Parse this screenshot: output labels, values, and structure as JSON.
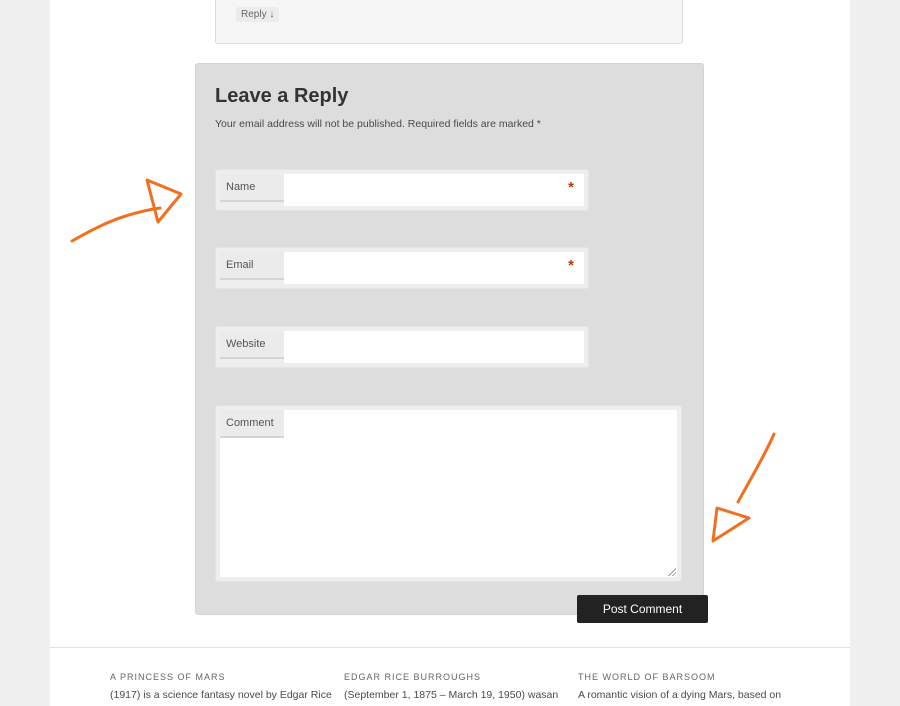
{
  "previous_comment": {
    "reply_label": "Reply ↓"
  },
  "reply_form": {
    "title": "Leave a Reply",
    "notes": "Your email address will not be published. Required fields are marked *",
    "fields": {
      "name": {
        "label": "Name",
        "required_mark": "*",
        "value": ""
      },
      "email": {
        "label": "Email",
        "required_mark": "*",
        "value": ""
      },
      "website": {
        "label": "Website",
        "value": ""
      },
      "comment": {
        "label": "Comment",
        "value": ""
      }
    },
    "submit_label": "Post Comment"
  },
  "footer": {
    "widgets": [
      {
        "title": "A PRINCESS OF MARS",
        "text": "(1917) is a science fantasy novel by Edgar Rice"
      },
      {
        "title": "EDGAR RICE BURROUGHS",
        "text": "(September 1, 1875 – March 19, 1950) wasan"
      },
      {
        "title": "THE WORLD OF BARSOOM",
        "text": "A romantic vision of a dying Mars, based on"
      }
    ]
  },
  "colors": {
    "annotation_arrow": "#f07020",
    "required_mark": "#bd3500",
    "submit_background": "#222222"
  }
}
